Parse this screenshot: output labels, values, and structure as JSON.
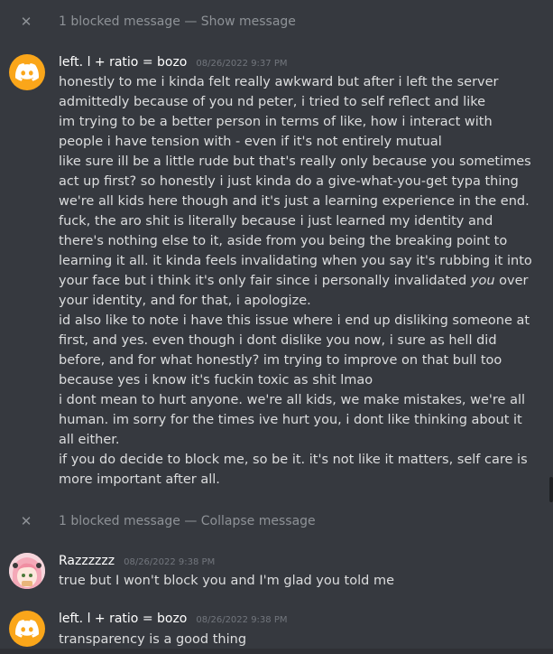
{
  "blocked_top": {
    "count_text": "1 blocked message",
    "sep": "—",
    "action": "Show message"
  },
  "msg1": {
    "username": "left. l + ratio = bozo",
    "timestamp": "08/26/2022 9:37 PM",
    "lines": [
      "honestly to me i kinda felt really awkward but after i left the server",
      "admittedly because of you nd peter, i tried to self reflect and like",
      "im trying to be a better person in terms of like, how i interact with",
      "people i have tension with - even if it's not entirely mutual",
      "like sure ill be a little rude but that's really only because you sometimes",
      "act up first? so honestly i just kinda do a give-what-you-get typa thing",
      "we're all kids here though and it's just a learning experience in the end.",
      "fuck, the aro shit is literally because i just learned my identity and",
      "there's nothing else to it, aside from you being the breaking point to",
      "learning it all. it kinda feels invalidating when you say it's rubbing it into",
      "your face but i think it's only fair since i personally invalidated",
      "your identity, and for that, i apologize.",
      "id also like to note i have this issue where i end up disliking someone at",
      "first, and yes. even though i dont dislike you now, i sure as hell did",
      "before, and for what honestly? im trying to improve on that bull too",
      "because yes i know it's fuckin toxic as shit lmao",
      "i dont mean to hurt anyone. we're all kids, we make mistakes, we're all",
      "human. im sorry for the times ive hurt you, i dont like thinking about it",
      "all either.",
      "if you do decide to block me, so be it. it's not like it matters, self care is",
      "more important after all."
    ],
    "line10_em": "you",
    "line10_tail": " over"
  },
  "blocked_mid": {
    "count_text": "1 blocked message",
    "sep": "—",
    "action": "Collapse message"
  },
  "msg2": {
    "username": "Razzzzzz",
    "timestamp": "08/26/2022 9:38 PM",
    "text": "true but I won't block you and I'm glad you told me"
  },
  "msg3": {
    "username": "left. l + ratio = bozo",
    "timestamp": "08/26/2022 9:38 PM",
    "text": "transparency is a good thing"
  },
  "colors": {
    "background": "#36393f",
    "text": "#dcddde",
    "muted": "#8e9297",
    "timestamp": "#72767d",
    "discord_avatar": "#faa61a"
  },
  "icons": {
    "close": "close-icon",
    "discord": "discord-logo-icon",
    "avatar_user": "anime-avatar-icon"
  }
}
